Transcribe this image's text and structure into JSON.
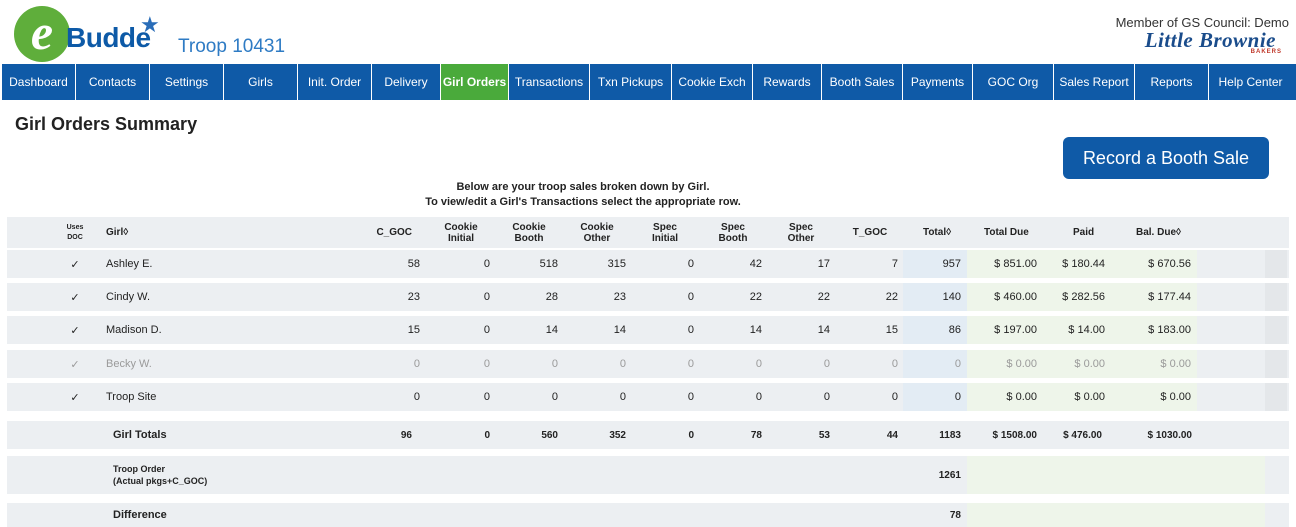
{
  "header": {
    "logo_e": "e",
    "logo_word": "Budde",
    "troop_name": "Troop 10431",
    "council": "Member of GS Council: Demo",
    "brand": "Little Brownie",
    "brand_sub": "BAKERS"
  },
  "nav": {
    "items": [
      "Dashboard",
      "Contacts",
      "Settings",
      "Girls",
      "Init. Order",
      "Delivery",
      "Girl Orders",
      "Transactions",
      "Txn Pickups",
      "Cookie Exch",
      "Rewards",
      "Booth Sales",
      "Payments",
      "GOC Org",
      "Sales Report",
      "Reports",
      "Help Center"
    ],
    "active": "Girl Orders",
    "colors": {
      "bar": "#0f5aa7",
      "active": "#4aaa3b"
    }
  },
  "page": {
    "title": "Girl Orders Summary",
    "booth_button": "Record a Booth Sale",
    "intro_line1": "Below are your troop sales broken down by Girl.",
    "intro_line2": "To view/edit a Girl's Transactions select the appropriate row."
  },
  "table": {
    "headers": {
      "uses_doc_1": "Uses",
      "uses_doc_2": "DOC",
      "girl": "Girl◊",
      "c_goc": "C_GOC",
      "cookie_initial_1": "Cookie",
      "cookie_initial_2": "Initial",
      "cookie_booth_1": "Cookie",
      "cookie_booth_2": "Booth",
      "cookie_other_1": "Cookie",
      "cookie_other_2": "Other",
      "spec_initial_1": "Spec",
      "spec_initial_2": "Initial",
      "spec_booth_1": "Spec",
      "spec_booth_2": "Booth",
      "spec_other_1": "Spec",
      "spec_other_2": "Other",
      "t_goc": "T_GOC",
      "total": "Total◊",
      "total_due": "Total Due",
      "paid": "Paid",
      "bal_due": "Bal. Due◊"
    },
    "rows": [
      {
        "doc": "✓",
        "girl": "Ashley E.",
        "c_goc": "58",
        "ci": "0",
        "cb": "518",
        "co": "315",
        "si": "0",
        "sb": "42",
        "so": "17",
        "t_goc": "7",
        "total": "957",
        "total_due": "$ 851.00",
        "paid": "$ 180.44",
        "bal_due": "$ 670.56"
      },
      {
        "doc": "✓",
        "girl": "Cindy W.",
        "c_goc": "23",
        "ci": "0",
        "cb": "28",
        "co": "23",
        "si": "0",
        "sb": "22",
        "so": "22",
        "t_goc": "22",
        "total": "140",
        "total_due": "$ 460.00",
        "paid": "$ 282.56",
        "bal_due": "$ 177.44"
      },
      {
        "doc": "✓",
        "girl": "Madison D.",
        "c_goc": "15",
        "ci": "0",
        "cb": "14",
        "co": "14",
        "si": "0",
        "sb": "14",
        "so": "14",
        "t_goc": "15",
        "total": "86",
        "total_due": "$ 197.00",
        "paid": "$ 14.00",
        "bal_due": "$ 183.00"
      },
      {
        "doc": "✓",
        "girl": "Becky W.",
        "c_goc": "0",
        "ci": "0",
        "cb": "0",
        "co": "0",
        "si": "0",
        "sb": "0",
        "so": "0",
        "t_goc": "0",
        "total": "0",
        "total_due": "$ 0.00",
        "paid": "$ 0.00",
        "bal_due": "$ 0.00"
      },
      {
        "doc": "✓",
        "girl": "Troop Site",
        "c_goc": "0",
        "ci": "0",
        "cb": "0",
        "co": "0",
        "si": "0",
        "sb": "0",
        "so": "0",
        "t_goc": "0",
        "total": "0",
        "total_due": "$ 0.00",
        "paid": "$ 0.00",
        "bal_due": "$ 0.00"
      }
    ],
    "totals": {
      "label": "Girl Totals",
      "c_goc": "96",
      "ci": "0",
      "cb": "560",
      "co": "352",
      "si": "0",
      "sb": "78",
      "so": "53",
      "t_goc": "44",
      "total": "1183",
      "total_due": "$ 1508.00",
      "paid": "$ 476.00",
      "bal_due": "$ 1030.00"
    },
    "troop_order": {
      "label_1": "Troop Order",
      "label_2": "(Actual pkgs+C_GOC)",
      "total": "1261"
    },
    "difference": {
      "label": "Difference",
      "total": "78"
    }
  }
}
